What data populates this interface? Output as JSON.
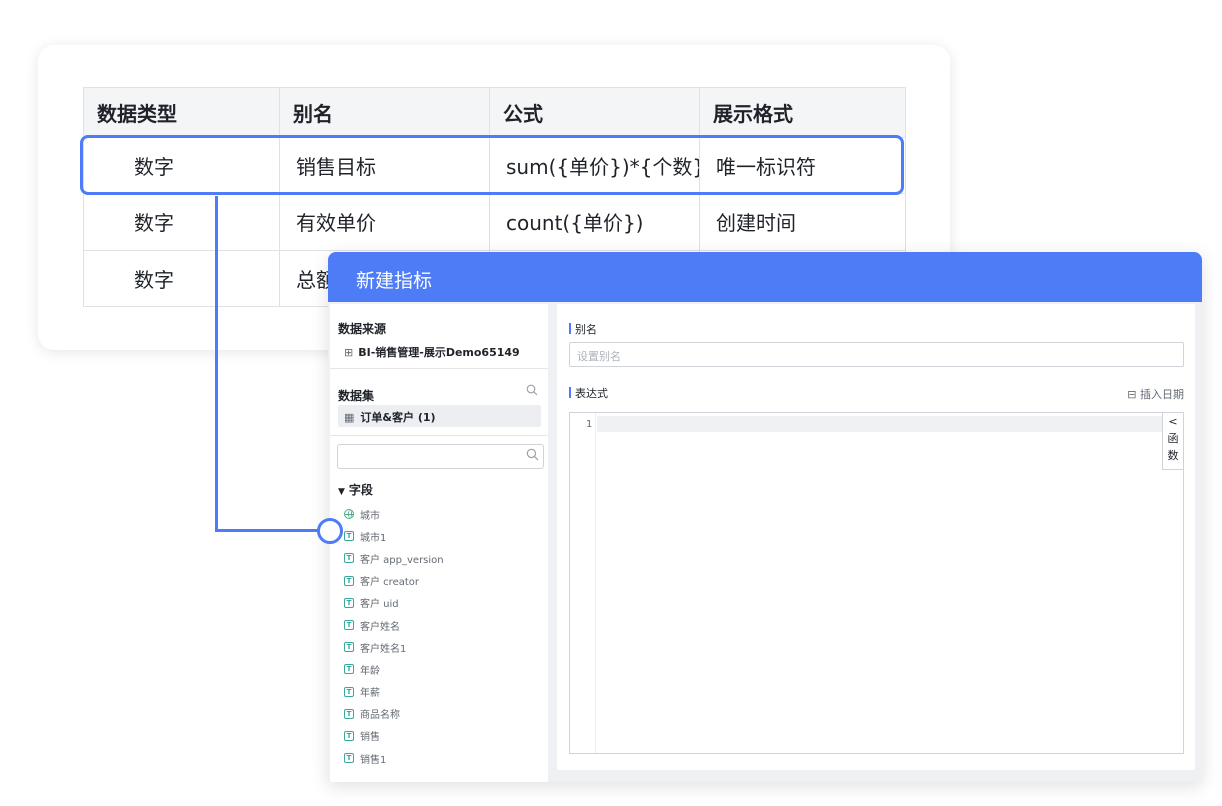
{
  "table": {
    "headers": [
      "数据类型",
      "别名",
      "公式",
      "展示格式"
    ],
    "rows": [
      [
        "数字",
        "销售目标",
        "sum({单价})*{个数})",
        "唯一标识符"
      ],
      [
        "数字",
        "有效单价",
        "count({单价})",
        "创建时间"
      ],
      [
        "数字",
        "总额",
        "",
        ""
      ]
    ],
    "highlighted_row": 0
  },
  "dialog": {
    "title": "新建指标",
    "data_source": {
      "title": "数据来源",
      "icon": "grid-icon",
      "value": "BI-销售管理-展示Demo65149"
    },
    "dataset": {
      "title": "数据集",
      "icon": "table-icon",
      "selected": "订单&客户 (1)"
    },
    "fields": {
      "title": "字段",
      "items": [
        {
          "label": "城市",
          "icon": "globe-icon"
        },
        {
          "label": "城市1",
          "icon": "text-type-icon"
        },
        {
          "label": "客户 app_version",
          "icon": "text-type-icon"
        },
        {
          "label": "客户 creator",
          "icon": "text-type-icon"
        },
        {
          "label": "客户 uid",
          "icon": "text-type-icon"
        },
        {
          "label": "客户姓名",
          "icon": "text-type-icon"
        },
        {
          "label": "客户姓名1",
          "icon": "text-type-icon"
        },
        {
          "label": "年龄",
          "icon": "text-type-icon"
        },
        {
          "label": "年薪",
          "icon": "text-type-icon"
        },
        {
          "label": "商品名称",
          "icon": "text-type-icon"
        },
        {
          "label": "销售",
          "icon": "text-type-icon"
        },
        {
          "label": "销售1",
          "icon": "text-type-icon"
        }
      ]
    },
    "alias": {
      "label": "别名",
      "placeholder": "设置别名"
    },
    "expression": {
      "label": "表达式",
      "insert_date": "插入日期",
      "line_number": "1",
      "function_tab": [
        "函",
        "数"
      ]
    }
  },
  "colors": {
    "accent": "#4e7bf6",
    "field_icon": "#3aa89c"
  }
}
